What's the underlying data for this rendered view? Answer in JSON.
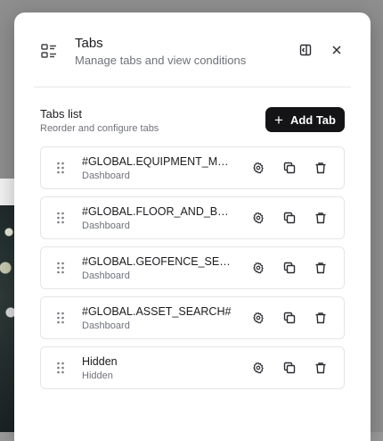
{
  "header": {
    "title": "Tabs",
    "subtitle": "Manage tabs and view conditions",
    "icon": "list-layout-icon",
    "collapse_icon": "panel-collapse-icon",
    "close_icon": "close-icon"
  },
  "tabs_list": {
    "title": "Tabs list",
    "subtitle": "Reorder and configure tabs",
    "add_label": "Add Tab"
  },
  "rows": [
    {
      "title": "#GLOBAL.EQUIPMENT_MA...",
      "subtitle": "Dashboard"
    },
    {
      "title": "#GLOBAL.FLOOR_AND_BE...",
      "subtitle": "Dashboard"
    },
    {
      "title": "#GLOBAL.GEOFENCE_SET...",
      "subtitle": "Dashboard"
    },
    {
      "title": "#GLOBAL.ASSET_SEARCH#",
      "subtitle": "Dashboard"
    },
    {
      "title": "Hidden",
      "subtitle": "Hidden"
    }
  ],
  "colors": {
    "primary_button": "#141416",
    "text": "#1b1b1f",
    "muted_text": "#70727a",
    "border": "#e4e5e8"
  }
}
